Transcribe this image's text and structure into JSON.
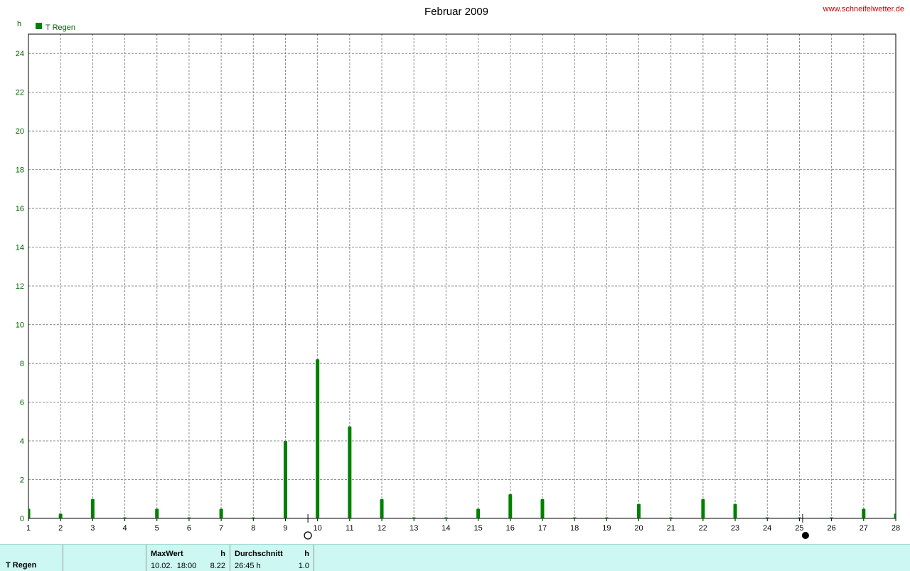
{
  "header": {
    "title": "Februar 2009",
    "website": "www.schneifelwetter.de",
    "unit": "h"
  },
  "legend": {
    "label": "T Regen",
    "color": "#008000"
  },
  "chart_data": {
    "type": "bar",
    "title": "Februar 2009",
    "ylabel": "h",
    "ylim": [
      0,
      25
    ],
    "yticks": [
      0,
      2,
      4,
      6,
      8,
      10,
      12,
      14,
      16,
      18,
      20,
      22,
      24
    ],
    "grid": true,
    "legend_position": "top-left",
    "categories": [
      "1",
      "2",
      "3",
      "4",
      "5",
      "6",
      "7",
      "8",
      "9",
      "10",
      "11",
      "12",
      "13",
      "14",
      "15",
      "16",
      "17",
      "18",
      "19",
      "20",
      "21",
      "22",
      "23",
      "24",
      "25",
      "26",
      "27",
      "28"
    ],
    "series": [
      {
        "name": "T Regen",
        "color": "#008000",
        "values": [
          0.5,
          0.25,
          1.0,
          0.0,
          0.5,
          0.0,
          0.5,
          0.0,
          4.0,
          8.22,
          4.75,
          1.0,
          0.0,
          0.0,
          0.5,
          1.25,
          1.0,
          0.0,
          0.0,
          0.75,
          0.0,
          1.0,
          0.75,
          0.0,
          0.0,
          0.0,
          0.5,
          0.25
        ]
      }
    ],
    "moon_phases": [
      {
        "day": 9.7,
        "phase": "full-moon"
      },
      {
        "day": 25.1,
        "phase": "new-moon"
      }
    ]
  },
  "stats": {
    "series_name": "T Regen",
    "max_header": "MaxWert",
    "max_unit": "h",
    "max_datetime": "10.02.  18:00",
    "max_value": "8.22",
    "avg_header": "Durchschnitt",
    "avg_unit": "h",
    "avg_total": "26:45 h",
    "avg_value": "1.0"
  }
}
